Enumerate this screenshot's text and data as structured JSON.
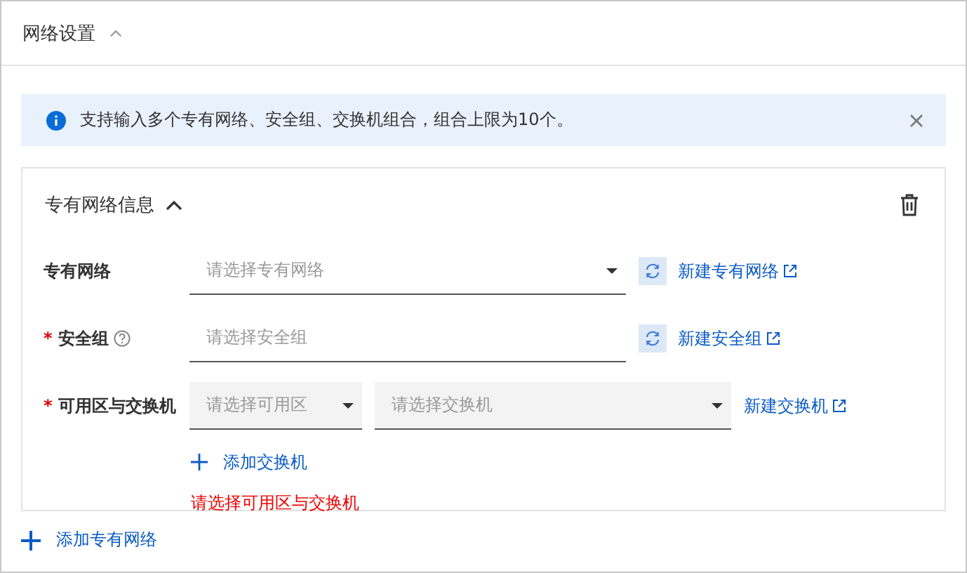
{
  "section": {
    "title": "网络设置",
    "expanded": true
  },
  "alert": {
    "text": "支持输入多个专有网络、安全组、交换机组合，组合上限为10个。"
  },
  "card": {
    "title": "专有网络信息",
    "expanded": true,
    "fields": [
      {
        "label": "专有网络",
        "required": false,
        "help": false,
        "refresh": true,
        "link": "新建专有网络",
        "selects": [
          {
            "kind": "select",
            "placeholder": "请选择专有网络",
            "disabled": false
          }
        ]
      },
      {
        "label": "安全组",
        "required": true,
        "help": true,
        "refresh": true,
        "link": "新建安全组",
        "selects": [
          {
            "kind": "input",
            "placeholder": "请选择安全组",
            "disabled": false
          }
        ]
      },
      {
        "label": "可用区与交换机",
        "required": true,
        "help": false,
        "refresh": false,
        "link": "新建交换机",
        "selects": [
          {
            "kind": "select",
            "placeholder": "请选择可用区",
            "disabled": true
          },
          {
            "kind": "select",
            "placeholder": "请选择交换机",
            "disabled": true
          }
        ]
      }
    ],
    "required_mark": "*",
    "add_switch": "添加交换机",
    "error": "请选择可用区与交换机"
  },
  "add_vpc": "添加专有网络"
}
